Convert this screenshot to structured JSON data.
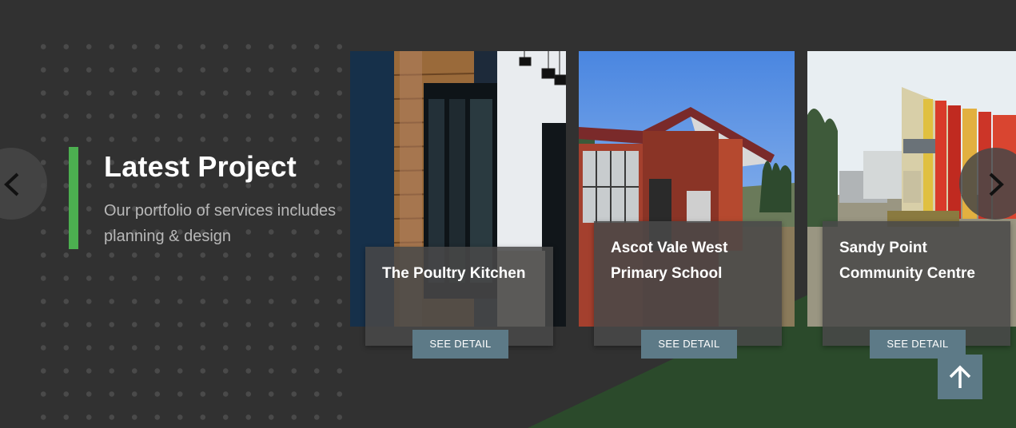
{
  "section": {
    "title": "Latest Project",
    "subtitle": "Our portfolio of services includes planning & design"
  },
  "carousel": {
    "prev_icon": "chevron-left-icon",
    "next_icon": "chevron-right-icon",
    "projects": [
      {
        "title": "The Poultry Kitchen",
        "button_label": "SEE DETAIL"
      },
      {
        "title": "Ascot Vale West Primary School",
        "button_label": "SEE DETAIL"
      },
      {
        "title": "Sandy Point Community Centre",
        "button_label": "SEE DETAIL"
      }
    ]
  },
  "scroll_top": {
    "icon": "arrow-up-icon"
  },
  "colors": {
    "background": "#313131",
    "accent_green": "#4caf50",
    "button": "#5d7a87",
    "lawn_green": "#2b4a2b"
  }
}
